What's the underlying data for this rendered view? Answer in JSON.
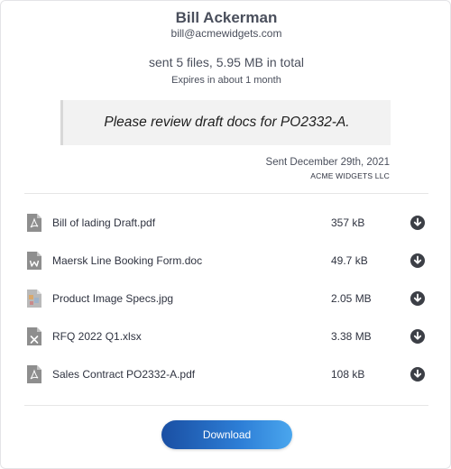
{
  "sender": {
    "name": "Bill Ackerman",
    "email": "bill@acmewidgets.com"
  },
  "summary": "sent 5 files, 5.95 MB in total",
  "expiry": "Expires in about 1 month",
  "message": "Please review draft docs for PO2332-A.",
  "sent_date": "Sent December 29th, 2021",
  "company": "ACME WIDGETS LLC",
  "files": [
    {
      "name": "Bill of lading Draft.pdf",
      "size": "357 kB",
      "icon": "pdf-file-icon"
    },
    {
      "name": "Maersk Line Booking Form.doc",
      "size": "49.7 kB",
      "icon": "word-file-icon"
    },
    {
      "name": "Product Image Specs.jpg",
      "size": "2.05 MB",
      "icon": "image-file-icon"
    },
    {
      "name": "RFQ 2022 Q1.xlsx",
      "size": "3.38 MB",
      "icon": "excel-file-icon"
    },
    {
      "name": "Sales Contract PO2332-A.pdf",
      "size": "108 kB",
      "icon": "pdf-file-icon"
    }
  ],
  "download_button": {
    "label": "Download"
  },
  "colors": {
    "icon_gray": "#8e8e8e",
    "download_icon": "#3c3f46",
    "button_start": "#1a4fa3",
    "button_end": "#4aa6ee"
  }
}
